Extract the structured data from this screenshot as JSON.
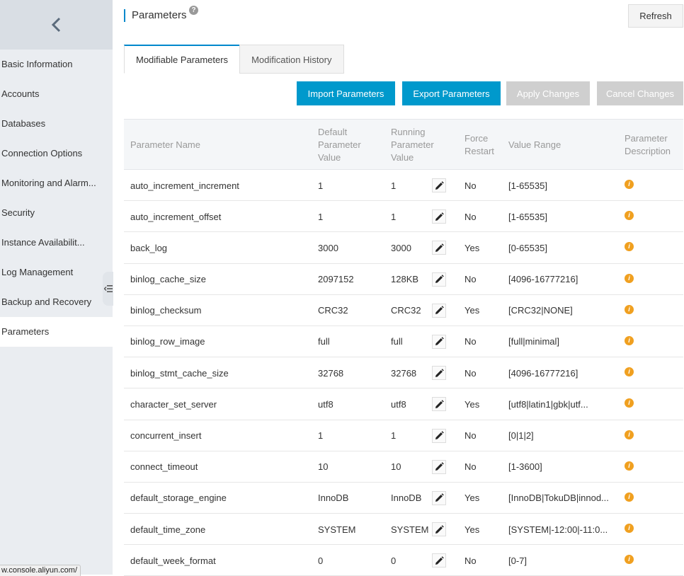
{
  "sidebar": {
    "items": [
      {
        "label": "Basic Information"
      },
      {
        "label": "Accounts"
      },
      {
        "label": "Databases"
      },
      {
        "label": "Connection Options"
      },
      {
        "label": "Monitoring and Alarm..."
      },
      {
        "label": "Security"
      },
      {
        "label": "Instance Availabilit..."
      },
      {
        "label": "Log Management"
      },
      {
        "label": "Backup and Recovery"
      },
      {
        "label": "Parameters"
      }
    ],
    "active_index": 9
  },
  "status_bar": {
    "url": "w.console.aliyun.com/"
  },
  "header": {
    "title": "Parameters",
    "help_glyph": "?",
    "refresh_label": "Refresh"
  },
  "tabs": [
    {
      "label": "Modifiable Parameters"
    },
    {
      "label": "Modification History"
    }
  ],
  "actions": {
    "import_label": "Import Parameters",
    "export_label": "Export Parameters",
    "apply_label": "Apply Changes",
    "cancel_label": "Cancel Changes"
  },
  "table": {
    "headers": {
      "name": "Parameter Name",
      "default": "Default Parameter Value",
      "running": "Running Parameter Value",
      "restart": "Force Restart",
      "range": "Value Range",
      "description": "Parameter Description"
    },
    "rows": [
      {
        "name": "auto_increment_increment",
        "default": "1",
        "running": "1",
        "restart": "No",
        "range": "[1-65535]"
      },
      {
        "name": "auto_increment_offset",
        "default": "1",
        "running": "1",
        "restart": "No",
        "range": "[1-65535]"
      },
      {
        "name": "back_log",
        "default": "3000",
        "running": "3000",
        "restart": "Yes",
        "range": "[0-65535]"
      },
      {
        "name": "binlog_cache_size",
        "default": "2097152",
        "running": "128KB",
        "restart": "No",
        "range": "[4096-16777216]"
      },
      {
        "name": "binlog_checksum",
        "default": "CRC32",
        "running": "CRC32",
        "restart": "Yes",
        "range": "[CRC32|NONE]"
      },
      {
        "name": "binlog_row_image",
        "default": "full",
        "running": "full",
        "restart": "No",
        "range": "[full|minimal]"
      },
      {
        "name": "binlog_stmt_cache_size",
        "default": "32768",
        "running": "32768",
        "restart": "No",
        "range": "[4096-16777216]"
      },
      {
        "name": "character_set_server",
        "default": "utf8",
        "running": "utf8",
        "restart": "Yes",
        "range": "[utf8|latin1|gbk|utf..."
      },
      {
        "name": "concurrent_insert",
        "default": "1",
        "running": "1",
        "restart": "No",
        "range": "[0|1|2]"
      },
      {
        "name": "connect_timeout",
        "default": "10",
        "running": "10",
        "restart": "No",
        "range": "[1-3600]"
      },
      {
        "name": "default_storage_engine",
        "default": "InnoDB",
        "running": "InnoDB",
        "restart": "Yes",
        "range": "[InnoDB|TokuDB|innod..."
      },
      {
        "name": "default_time_zone",
        "default": "SYSTEM",
        "running": "SYSTEM",
        "restart": "Yes",
        "range": "[SYSTEM|-12:00|-11:0..."
      },
      {
        "name": "default_week_format",
        "default": "0",
        "running": "0",
        "restart": "No",
        "range": "[0-7]"
      }
    ],
    "info_glyph": "i"
  },
  "icons": {
    "back": "chevron-left-icon",
    "collapse": "collapse-menu-icon",
    "edit": "pencil-icon",
    "info": "info-icon",
    "help": "help-icon"
  },
  "colors": {
    "accent": "#0099cc",
    "info": "#f0a020",
    "disabled": "#cfcfcf",
    "sidebar_bg": "#eaedf1"
  }
}
